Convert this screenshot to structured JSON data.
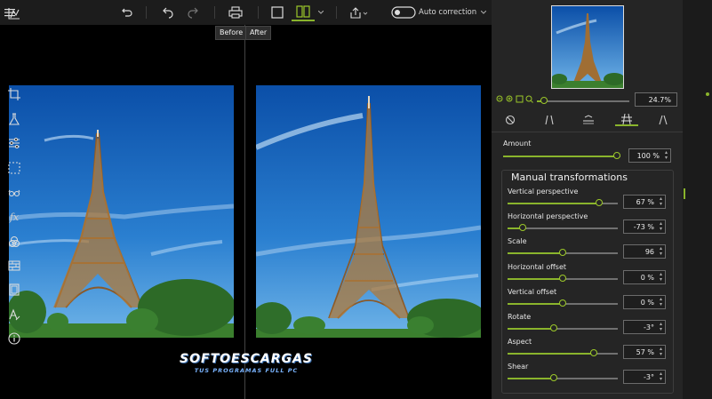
{
  "toolbar": {
    "menu_icon": "hamburger-menu-icon",
    "toggle_label": "Auto correction",
    "toggle_on": false,
    "accent": "#8ab42c"
  },
  "compare": {
    "before_label": "Before",
    "after_label": "After"
  },
  "watermark": {
    "title": "SOFTOESCARGAS",
    "subtitle": "TUS PROGRAMAS FULL PC"
  },
  "navigator": {
    "zoom_value": "24.7%",
    "zoom_level": 0.08
  },
  "adjust": {
    "amount_label": "Amount",
    "amount_value": "100 %",
    "amount_level": 1.0,
    "group_title": "Manual transformations",
    "rows": [
      {
        "label": "Vertical perspective",
        "value": "67 %",
        "level": 0.83
      },
      {
        "label": "Horizontal perspective",
        "value": "-73 %",
        "level": 0.14
      },
      {
        "label": "Scale",
        "value": "96",
        "level": 0.5
      },
      {
        "label": "Horizontal offset",
        "value": "0 %",
        "level": 0.5
      },
      {
        "label": "Vertical offset",
        "value": "0 %",
        "level": 0.5
      },
      {
        "label": "Rotate",
        "value": "-3°",
        "level": 0.42
      },
      {
        "label": "Aspect",
        "value": "57 %",
        "level": 0.78
      },
      {
        "label": "Shear",
        "value": "-3°",
        "level": 0.42
      }
    ]
  }
}
